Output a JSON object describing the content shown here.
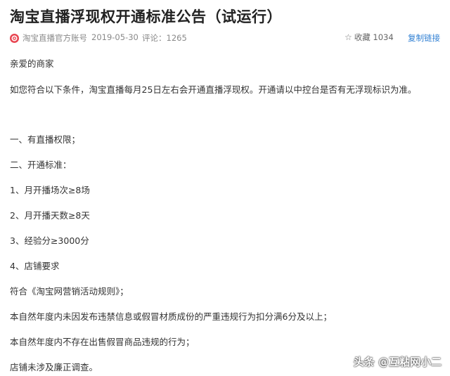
{
  "article": {
    "title": "淘宝直播浮现权开通标准公告（试运行）",
    "meta": {
      "logo_icon": "taobao-live-logo-icon",
      "account": "淘宝直播官方账号",
      "date": "2019-05-30",
      "comments": "评论：1265",
      "favorite_icon": "star-outline-icon",
      "favorite": "收藏 1034",
      "copy_link": "复制链接"
    },
    "paragraphs": [
      "亲爱的商家",
      "如您符合以下条件，淘宝直播每月25日左右会开通直播浮现权。开通请以中控台是否有无浮现标识为准。",
      "一、有直播权限；",
      "二、开通标准：",
      "1、月开播场次≥8场",
      "2、月开播天数≥8天",
      "3、经验分≥3000分",
      "4、店铺要求",
      "符合《淘宝网营销活动规则》；",
      "本自然年度内未因发布违禁信息或假冒材质成份的严重违规行为扣分满6分及以上；",
      "本自然年度内不存在出售假冒商品违规的行为；",
      "店铺未涉及廉正调查。"
    ]
  },
  "watermark": "头条 @互粘网小二",
  "colors": {
    "title": "#222222",
    "meta": "#8a8a8a",
    "link": "#2f7fd3",
    "logo": "#e8434f"
  }
}
